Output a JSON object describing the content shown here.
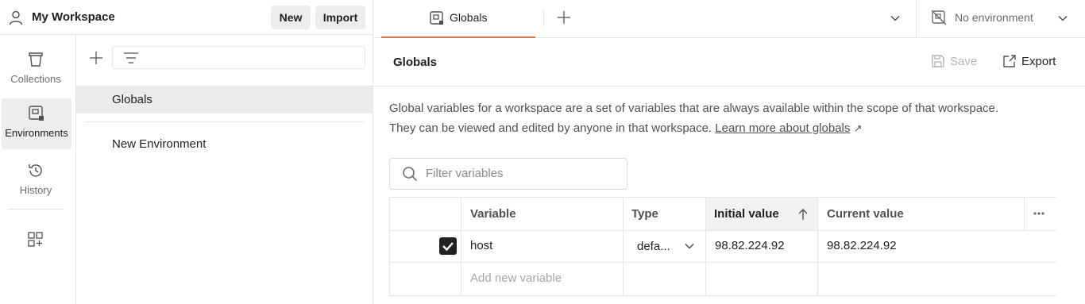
{
  "workspace": {
    "title": "My Workspace",
    "new_label": "New",
    "import_label": "Import"
  },
  "tabs": {
    "active_label": "Globals",
    "environment_label": "No environment"
  },
  "sidebar": {
    "items": [
      {
        "label": "Collections",
        "icon": "trash-can-collections-icon"
      },
      {
        "label": "Environments",
        "icon": "environment-icon"
      },
      {
        "label": "History",
        "icon": "history-icon"
      },
      {
        "label": "",
        "icon": "add-apps-icon"
      }
    ]
  },
  "env_list": {
    "items": [
      "Globals",
      "New Environment"
    ]
  },
  "main": {
    "title": "Globals",
    "save_label": "Save",
    "export_label": "Export",
    "description_line1": "Global variables for a workspace are a set of variables that are always available within the scope of that workspace.",
    "description_line2": "They can be viewed and edited by anyone in that workspace.",
    "learn_more": "Learn more about globals",
    "learn_more_arrow": "↗",
    "filter_placeholder": "Filter variables"
  },
  "table": {
    "headers": {
      "variable": "Variable",
      "type": "Type",
      "initial": "Initial value",
      "current": "Current value"
    },
    "rows": [
      {
        "checked": true,
        "variable": "host",
        "type": "defa...",
        "initial": "98.82.224.92",
        "current": "98.82.224.92"
      }
    ],
    "add_placeholder": "Add new variable"
  },
  "colors": {
    "accent": "#f26b3a",
    "active_bg": "#ebebeb"
  }
}
